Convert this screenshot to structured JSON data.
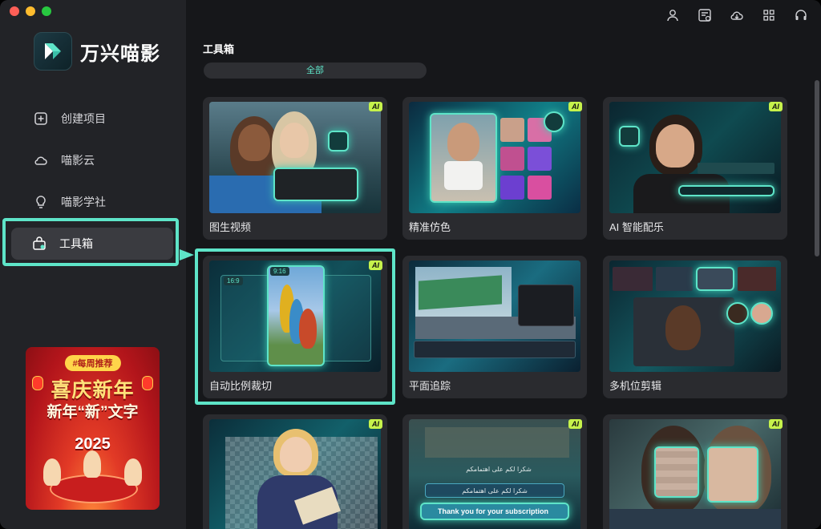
{
  "brand": {
    "name": "万兴喵影"
  },
  "nav": [
    {
      "label": "创建项目",
      "icon": "plus-square-icon"
    },
    {
      "label": "喵影云",
      "icon": "cloud-icon"
    },
    {
      "label": "喵影学社",
      "icon": "lightbulb-icon"
    },
    {
      "label": "工具箱",
      "icon": "toolbox-icon",
      "active": true
    }
  ],
  "topbar": [
    "user-icon",
    "task-list-icon",
    "cloud-download-icon",
    "grid-apps-icon",
    "headset-icon"
  ],
  "promo": {
    "tag": "#每周推荐",
    "title": "喜庆新年",
    "subtitle": "新年“新”文字",
    "year": "2025"
  },
  "main": {
    "title": "工具箱",
    "filter": "全部"
  },
  "cards": [
    {
      "label": "图生视频",
      "ai": "AI"
    },
    {
      "label": "精准仿色",
      "ai": "AI"
    },
    {
      "label": "AI 智能配乐",
      "ai": "AI"
    },
    {
      "label": "自动比例裁切",
      "ai": "AI",
      "ratio_badge": "9:16",
      "ratio_badge2": "16:9"
    },
    {
      "label": "平面追踪",
      "ai": ""
    },
    {
      "label": "多机位剪辑",
      "ai": ""
    },
    {
      "label": "",
      "ai": "AI"
    },
    {
      "label": "",
      "ai": "AI",
      "caption_ar": "شكرا لكم على اهتمامكم",
      "caption_en": "Thank you for your subscription"
    },
    {
      "label": "",
      "ai": "AI"
    }
  ],
  "colors": {
    "accent": "#5ee4c8",
    "ai_badge": "#c6f24b",
    "sidebar": "#222327",
    "bg": "#16171a"
  }
}
